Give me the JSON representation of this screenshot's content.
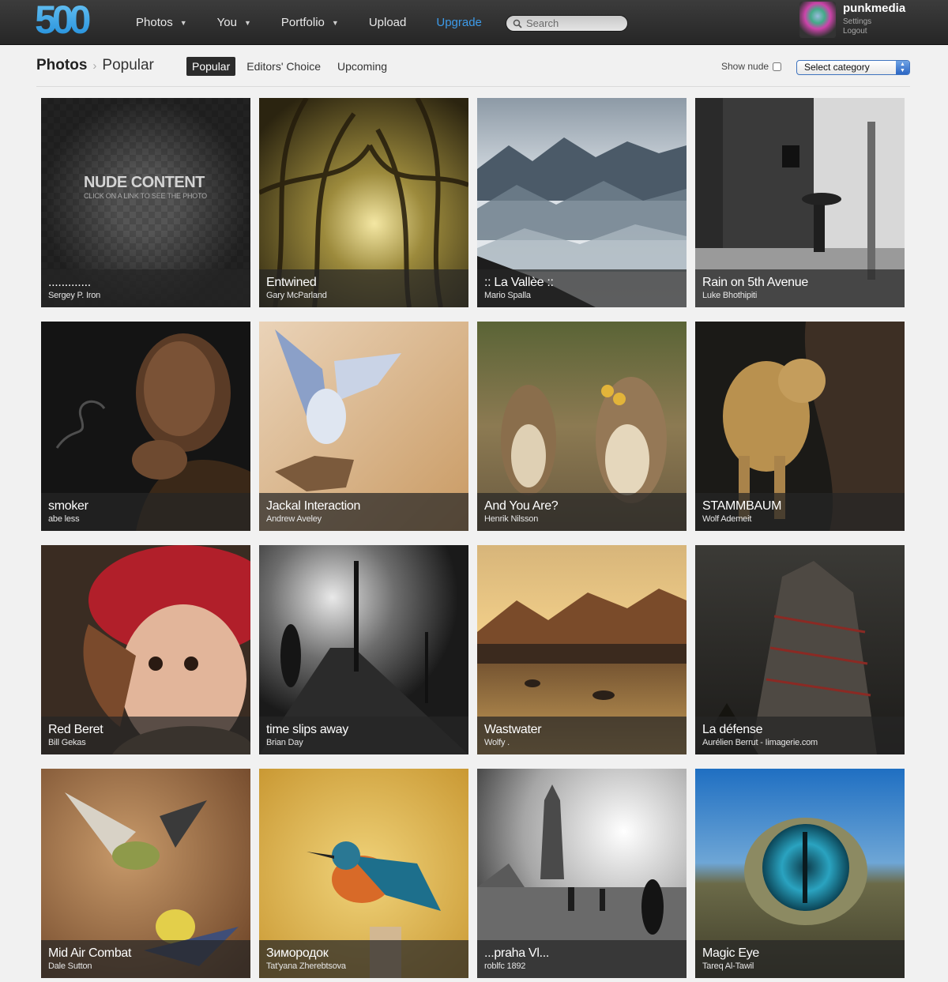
{
  "app": {
    "logo_text": "500",
    "nav": [
      {
        "label": "Photos",
        "has_caret": true
      },
      {
        "label": "You",
        "has_caret": true
      },
      {
        "label": "Portfolio",
        "has_caret": true
      },
      {
        "label": "Upload",
        "has_caret": false
      },
      {
        "label": "Upgrade",
        "has_caret": false
      }
    ],
    "search": {
      "placeholder": "Search"
    },
    "user": {
      "name": "punkmedia",
      "settings_label": "Settings",
      "logout_label": "Logout"
    }
  },
  "subbar": {
    "breadcrumb": [
      "Photos",
      "Popular"
    ],
    "tabs": [
      "Popular",
      "Editors' Choice",
      "Upcoming"
    ],
    "active_tab": "Popular",
    "show_nude_label": "Show nude",
    "show_nude_checked": false,
    "category_selected": "Select category"
  },
  "nude_overlay": {
    "title": "NUDE CONTENT",
    "subtitle": "CLICK ON A LINK TO SEE THE PHOTO"
  },
  "photos": [
    {
      "title": ".............",
      "author": "Sergey P. Iron"
    },
    {
      "title": "Entwined",
      "author": "Gary McParland"
    },
    {
      "title": ":: La Vallèe ::",
      "author": "Mario Spalla"
    },
    {
      "title": "Rain on 5th Avenue",
      "author": "Luke Bhothipiti"
    },
    {
      "title": "smoker",
      "author": "abe less"
    },
    {
      "title": "Jackal Interaction",
      "author": "Andrew Aveley"
    },
    {
      "title": "And You Are?",
      "author": "Henrik Nilsson"
    },
    {
      "title": "STAMMBAUM",
      "author": "Wolf Ademeit"
    },
    {
      "title": "Red Beret",
      "author": "Bill Gekas"
    },
    {
      "title": "time slips away",
      "author": "Brian Day"
    },
    {
      "title": "Wastwater",
      "author": "Wolfy ."
    },
    {
      "title": "La défense",
      "author": "Aurélien Berrut - Iimagerie.com"
    },
    {
      "title": "Mid Air Combat",
      "author": "Dale Sutton"
    },
    {
      "title": "Зимородок",
      "author": "Tat'yana Zherebtsova"
    },
    {
      "title": "...praha Vl...",
      "author": "roblfc 1892"
    },
    {
      "title": "Magic Eye",
      "author": "Tareq Al-Tawil"
    }
  ],
  "colors": {
    "accent": "#3d9be9",
    "topbar": "#2e2e2e",
    "background": "#f1f1f1"
  }
}
